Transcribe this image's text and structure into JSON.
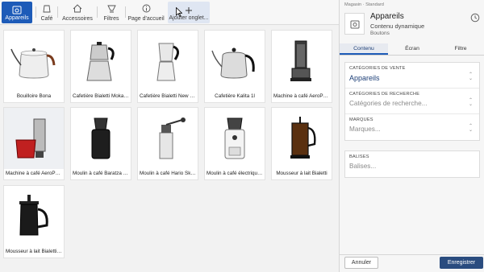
{
  "tabs": [
    {
      "label": "Appareils",
      "icon": "appliances-icon",
      "active": true
    },
    {
      "label": "Café",
      "icon": "coffee-bag-icon"
    },
    {
      "label": "Accessoires",
      "icon": "home-icon"
    },
    {
      "label": "Filtres",
      "icon": "filter-cup-icon"
    },
    {
      "label": "Page d'accueil",
      "icon": "info-icon"
    },
    {
      "label": "Ajouter onglet...",
      "icon": "plus-icon"
    }
  ],
  "products": [
    {
      "name": "Bouilloire Bona"
    },
    {
      "name": "Cafetière Bialetti Moka Express"
    },
    {
      "name": "Cafetière Bialetti New Venus"
    },
    {
      "name": "Cafetière Kalita 1l"
    },
    {
      "name": "Machine à café AeroPress"
    },
    {
      "name": "Machine à café AeroPress Go"
    },
    {
      "name": "Moulin à café Baratza Encore"
    },
    {
      "name": "Moulin à café Hario Skerton"
    },
    {
      "name": "Moulin à café électrique Baratza"
    },
    {
      "name": "Mousseur à lait Bialetti"
    },
    {
      "name": "Mousseur à lait Bialetti Tuttocrema"
    }
  ],
  "panel": {
    "breadcrumb": "Magasin · Standard",
    "title": "Appareils",
    "subtitle": "Contenu dynamique",
    "type": "Boutons",
    "tabs": [
      "Contenu",
      "Écran",
      "Filtre"
    ],
    "sales_category_label": "CATÉGORIES DE VENTE",
    "sales_category_value": "Appareils",
    "search_category_label": "CATÉGORIES DE RECHERCHE",
    "search_category_placeholder": "Catégories de recherche...",
    "brands_label": "MARQUES",
    "brands_placeholder": "Marques...",
    "tags_label": "BALISES",
    "tags_placeholder": "Balises...",
    "cancel_label": "Annuler",
    "save_label": "Enregistrer"
  },
  "colors": {
    "accent": "#1d5bb8",
    "save": "#2a4c7f"
  }
}
